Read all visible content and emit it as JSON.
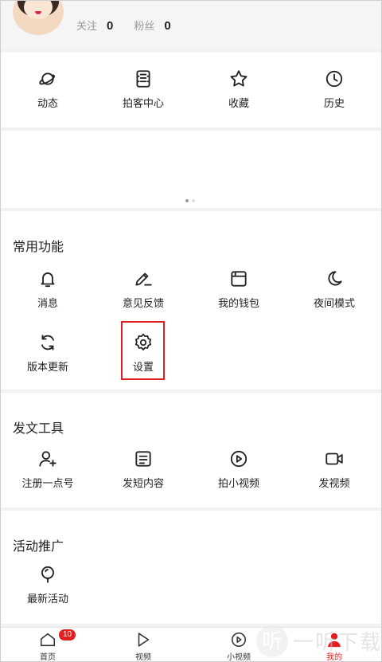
{
  "profile": {
    "following_label": "关注",
    "following_count": "0",
    "followers_label": "粉丝",
    "followers_count": "0"
  },
  "quick": [
    {
      "label": "动态",
      "icon": "planet-icon"
    },
    {
      "label": "拍客中心",
      "icon": "film-icon"
    },
    {
      "label": "收藏",
      "icon": "star-icon"
    },
    {
      "label": "历史",
      "icon": "clock-icon"
    }
  ],
  "banner": {
    "dots": 2,
    "active": 0
  },
  "common": {
    "title": "常用功能",
    "items": [
      {
        "label": "消息",
        "icon": "bell-icon"
      },
      {
        "label": "意见反馈",
        "icon": "pen-icon"
      },
      {
        "label": "我的钱包",
        "icon": "wallet-icon"
      },
      {
        "label": "夜间模式",
        "icon": "moon-icon"
      },
      {
        "label": "版本更新",
        "icon": "refresh-icon"
      },
      {
        "label": "设置",
        "icon": "gear-icon"
      }
    ]
  },
  "tools": {
    "title": "发文工具",
    "items": [
      {
        "label": "注册一点号",
        "icon": "add-user-icon"
      },
      {
        "label": "发短内容",
        "icon": "document-icon"
      },
      {
        "label": "拍小视频",
        "icon": "play-circle-icon"
      },
      {
        "label": "发视频",
        "icon": "video-camera-icon"
      }
    ]
  },
  "promo": {
    "title": "活动推广",
    "items": [
      {
        "label": "最新活动",
        "icon": "balloon-icon"
      }
    ]
  },
  "tabbar": {
    "tabs": [
      {
        "label": "首页",
        "icon": "home-icon"
      },
      {
        "label": "视频",
        "icon": "play-icon"
      },
      {
        "label": "小视频",
        "icon": "play-circle-icon"
      },
      {
        "label": "我的",
        "icon": "person-icon"
      }
    ],
    "home_badge": "10",
    "active": 3
  },
  "colors": {
    "accent": "#e02020",
    "text": "#222222",
    "muted": "#999999",
    "background": "#f2f2f2"
  },
  "watermark": {
    "logo": "听",
    "text": "一听下载"
  }
}
